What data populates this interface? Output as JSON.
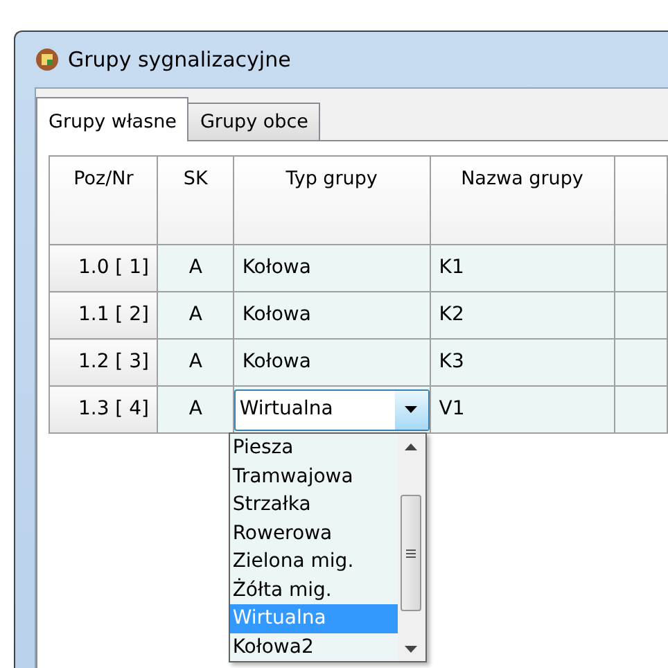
{
  "window": {
    "title": "Grupy sygnalizacyjne"
  },
  "tabs": [
    {
      "label": "Grupy własne",
      "selected": true
    },
    {
      "label": "Grupy obce",
      "selected": false
    }
  ],
  "table": {
    "columns": [
      "Poz/Nr",
      "SK",
      "Typ grupy",
      "Nazwa grupy"
    ],
    "rows": [
      {
        "position": "1.0 [ 1]",
        "sk": "A",
        "type": "Kołowa",
        "name": "K1",
        "editing": false
      },
      {
        "position": "1.1 [ 2]",
        "sk": "A",
        "type": "Kołowa",
        "name": "K2",
        "editing": false
      },
      {
        "position": "1.2 [ 3]",
        "sk": "A",
        "type": "Kołowa",
        "name": "K3",
        "editing": false
      },
      {
        "position": "1.3 [ 4]",
        "sk": "A",
        "type": "Wirtualna",
        "name": "V1",
        "editing": true
      }
    ]
  },
  "dropdown": {
    "items": [
      {
        "label": "Piesza",
        "selected": false
      },
      {
        "label": "Tramwajowa",
        "selected": false
      },
      {
        "label": "Strzałka",
        "selected": false
      },
      {
        "label": "Rowerowa",
        "selected": false
      },
      {
        "label": "Zielona mig.",
        "selected": false
      },
      {
        "label": "Żółta mig.",
        "selected": false
      },
      {
        "label": "Wirtualna",
        "selected": true
      },
      {
        "label": "Kołowa2",
        "selected": false
      }
    ]
  }
}
